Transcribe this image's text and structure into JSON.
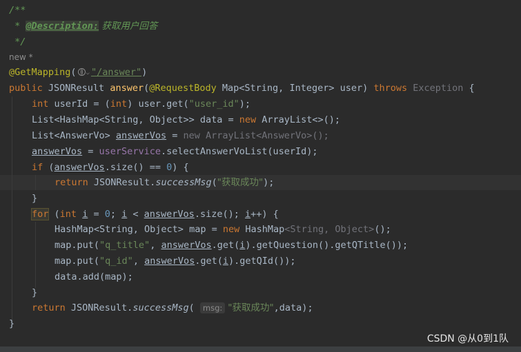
{
  "doc": {
    "open": "/**",
    "star": " * ",
    "tag": "@Description:",
    "desc": " 获取用户回答",
    "close": " */"
  },
  "hint": "new *",
  "mapping": {
    "annotation": "@GetMapping",
    "open": "(",
    "path": "\"/answer\"",
    "close": ")"
  },
  "code": {
    "sig_public": "public ",
    "sig_type": "JSONResult ",
    "sig_name": "answer",
    "sig_open": "(",
    "sig_ann": "@RequestBody ",
    "sig_param": "Map<String, Integer> user) ",
    "sig_throws": "throws",
    "sig_exc": " Exception",
    "sig_end": " {",
    "l1_kw": "int",
    "l1_a": " userId = (",
    "l1_kw2": "int",
    "l1_b": ") user.get(",
    "l1_str": "\"user_id\"",
    "l1_c": ");",
    "l2_a": "List<HashMap<String, Object>> data = ",
    "l2_kw": "new",
    "l2_b": " ArrayList<>();",
    "l3_a": "List<AnswerVo> ",
    "l3_var": "answerVos",
    "l3_b": " = ",
    "l3_dim": "new ArrayList<AnswerVo>();",
    "l4_var": "answerVos",
    "l4_a": " = ",
    "l4_field": "userService",
    "l4_b": ".selectAnswerVoList(userId);",
    "l5_kw": "if",
    "l5_a": " (",
    "l5_var": "answerVos",
    "l5_b": ".size() == ",
    "l5_num": "0",
    "l5_c": ") {",
    "l6_kw": "return",
    "l6_a": " JSONResult.",
    "l6_static": "successMsg",
    "l6_b": "(",
    "l6_str": "\"获取成功\"",
    "l6_c": ");",
    "l7": "}",
    "l8_kw": "for",
    "l8_a": " (",
    "l8_kw2": "int",
    "l8_b": " ",
    "l8_i": "i",
    "l8_c": " = ",
    "l8_num": "0",
    "l8_d": "; ",
    "l8_i2": "i",
    "l8_e": " < ",
    "l8_var": "answerVos",
    "l8_f": ".size(); ",
    "l8_i3": "i",
    "l8_g": "++) {",
    "l9_a": "HashMap<String, Object> map = ",
    "l9_kw": "new",
    "l9_b": " HashMap",
    "l9_dim": "<String, Object>",
    "l9_c": "();",
    "l10_a": "map.put(",
    "l10_str": "\"q_title\"",
    "l10_b": ", ",
    "l10_var": "answerVos",
    "l10_c": ".get(",
    "l10_i": "i",
    "l10_d": ").getQuestion().getQTitle());",
    "l11_a": "map.put(",
    "l11_str": "\"q_id\"",
    "l11_b": ", ",
    "l11_var": "answerVos",
    "l11_c": ".get(",
    "l11_i": "i",
    "l11_d": ").getQId());",
    "l12": "data.add(map);",
    "l13": "}",
    "l14_kw": "return",
    "l14_a": " JSONResult.",
    "l14_static": "successMsg",
    "l14_b": "( ",
    "l14_hint": "msg:",
    "l14_str": "\"获取成功\"",
    "l14_c": ",data);",
    "close": "}"
  },
  "watermark": "CSDN @从0到1队"
}
